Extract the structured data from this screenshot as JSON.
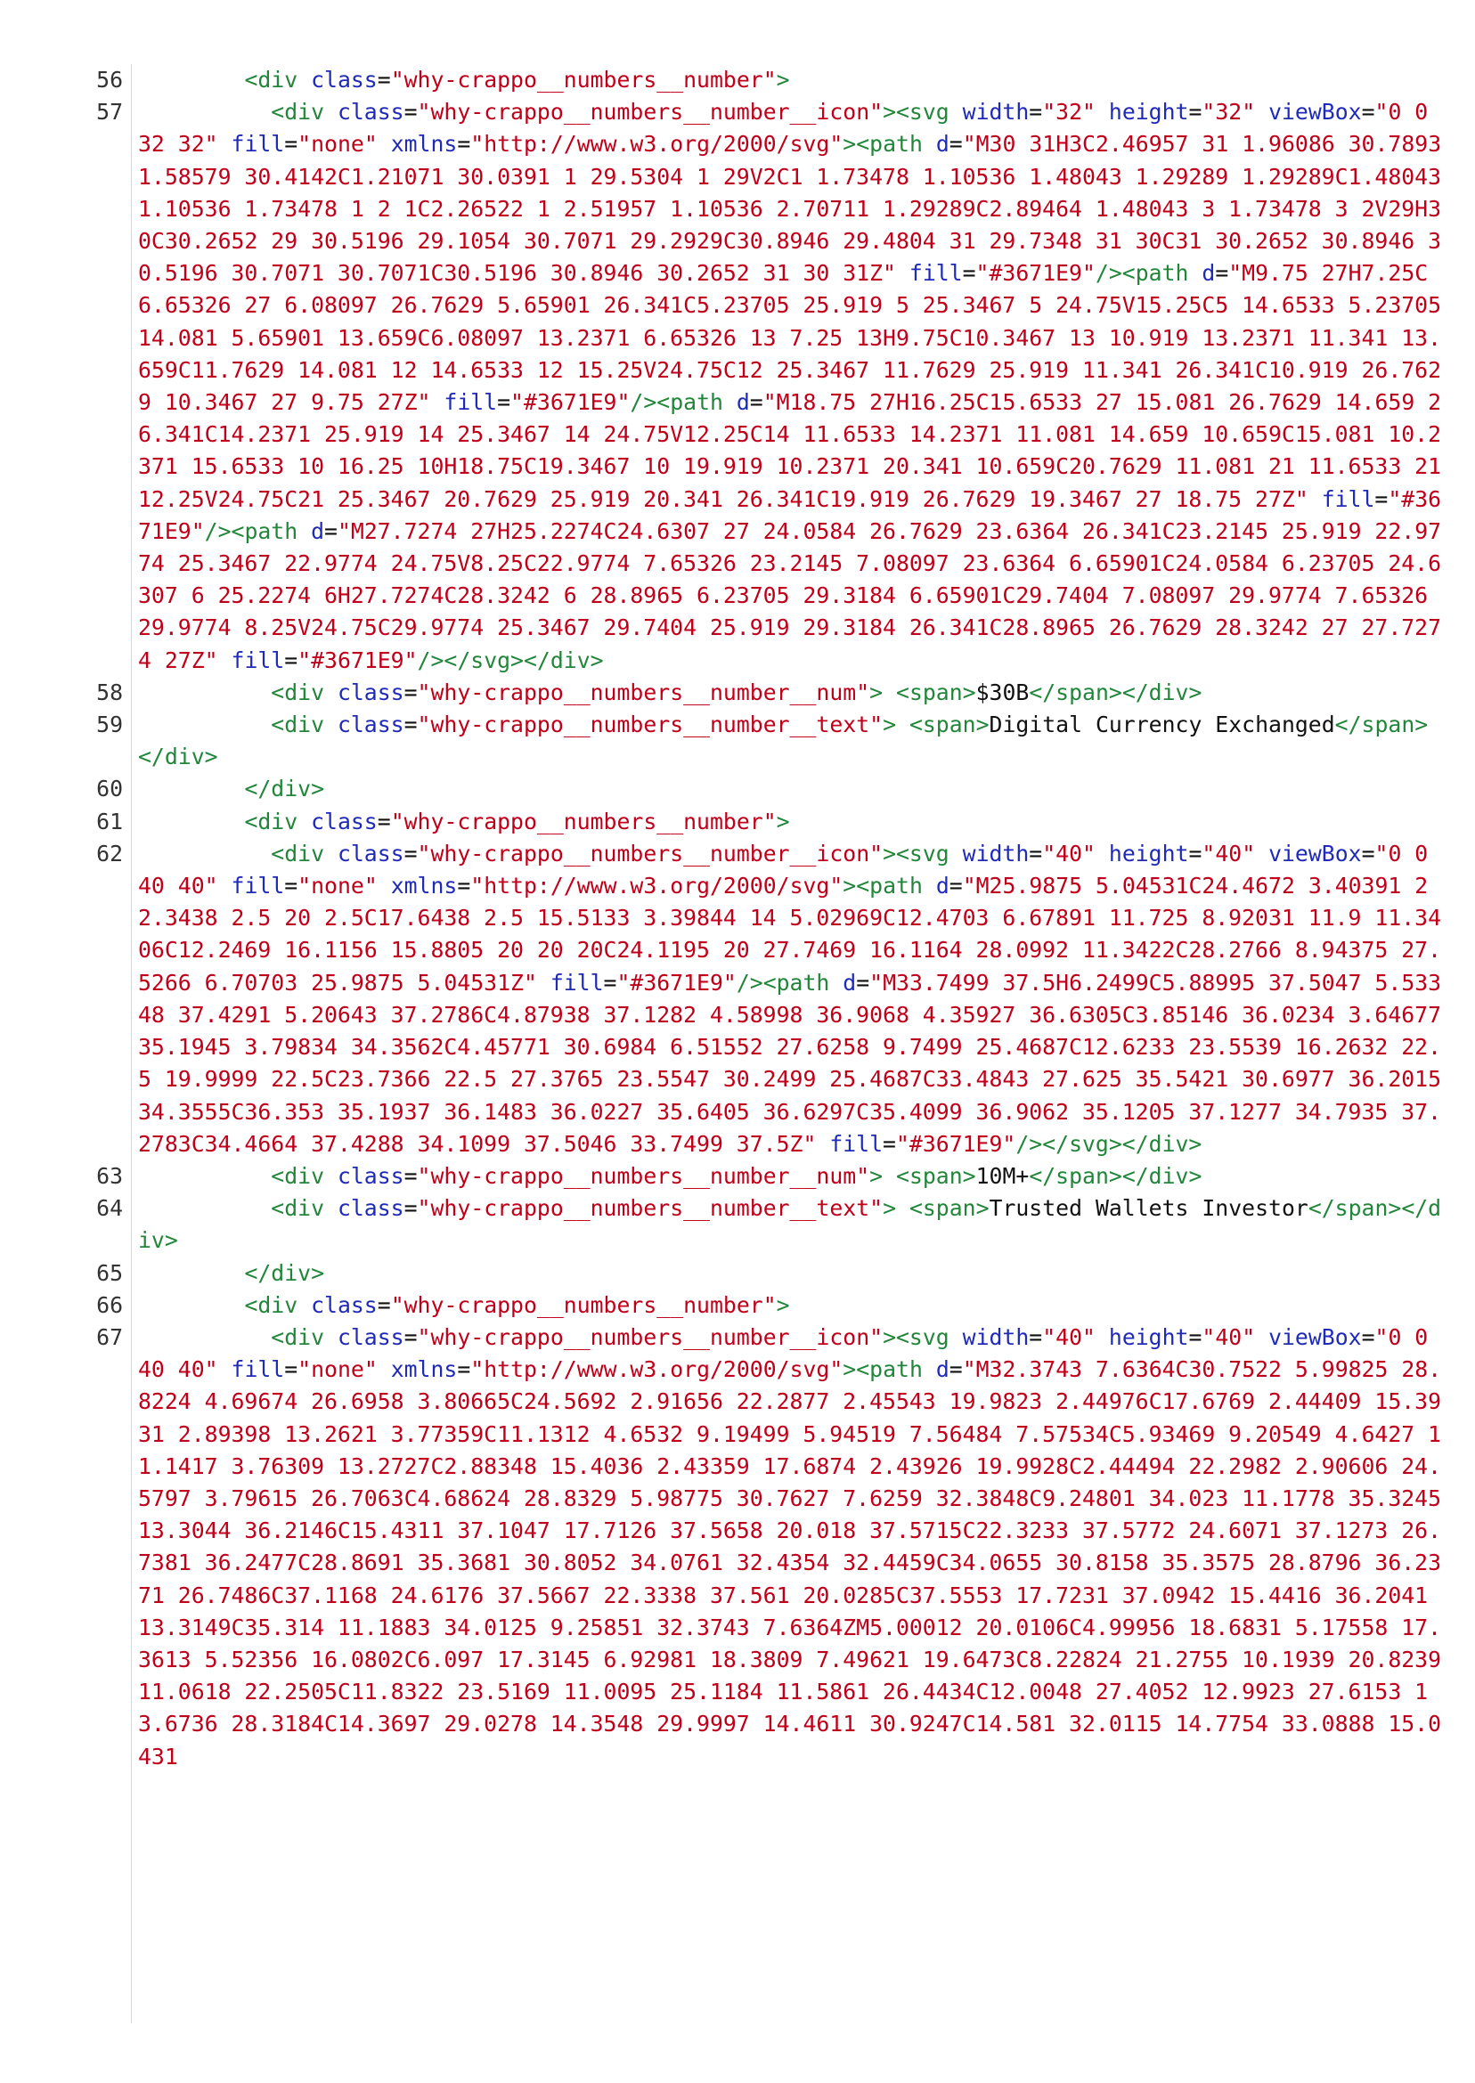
{
  "lines": [
    {
      "num": "56",
      "indent": "        ",
      "tokens": [
        {
          "t": "tg",
          "v": "<div "
        },
        {
          "t": "an",
          "v": "class"
        },
        {
          "t": "tx",
          "v": "="
        },
        {
          "t": "av",
          "v": "\"why-crappo__numbers__number\""
        },
        {
          "t": "tg",
          "v": ">"
        }
      ]
    },
    {
      "num": "57",
      "indent": "          ",
      "tokens": [
        {
          "t": "tg",
          "v": "<div "
        },
        {
          "t": "an",
          "v": "class"
        },
        {
          "t": "tx",
          "v": "="
        },
        {
          "t": "av",
          "v": "\"why-crappo__numbers__number__icon\""
        },
        {
          "t": "tg",
          "v": "><svg "
        },
        {
          "t": "an",
          "v": "width"
        },
        {
          "t": "tx",
          "v": "="
        },
        {
          "t": "av",
          "v": "\"32\""
        },
        {
          "t": "tx",
          "v": " "
        },
        {
          "t": "an",
          "v": "height"
        },
        {
          "t": "tx",
          "v": "="
        },
        {
          "t": "av",
          "v": "\"32\""
        },
        {
          "t": "tx",
          "v": " "
        },
        {
          "t": "an",
          "v": "viewBox"
        },
        {
          "t": "tx",
          "v": "="
        },
        {
          "t": "av",
          "v": "\"0 0 32 32\""
        },
        {
          "t": "tx",
          "v": " "
        },
        {
          "t": "an",
          "v": "fill"
        },
        {
          "t": "tx",
          "v": "="
        },
        {
          "t": "av",
          "v": "\"none\""
        },
        {
          "t": "tx",
          "v": " "
        },
        {
          "t": "an",
          "v": "xmlns"
        },
        {
          "t": "tx",
          "v": "="
        },
        {
          "t": "av",
          "v": "\"http://www.w3.org/2000/svg\""
        },
        {
          "t": "tg",
          "v": "><path "
        },
        {
          "t": "an",
          "v": "d"
        },
        {
          "t": "tx",
          "v": "="
        },
        {
          "t": "av",
          "v": "\"M30 31H3C2.46957 31 1.96086 30.7893 1.58579 30.4142C1.21071 30.0391 1 29.5304 1 29V2C1 1.73478 1.10536 1.48043 1.29289 1.29289C1.48043 1.10536 1.73478 1 2 1C2.26522 1 2.51957 1.10536 2.70711 1.29289C2.89464 1.48043 3 1.73478 3 2V29H30C30.2652 29 30.5196 29.1054 30.7071 29.2929C30.8946 29.4804 31 29.7348 31 30C31 30.2652 30.8946 30.5196 30.7071 30.7071C30.5196 30.8946 30.2652 31 30 31Z\""
        },
        {
          "t": "tx",
          "v": " "
        },
        {
          "t": "an",
          "v": "fill"
        },
        {
          "t": "tx",
          "v": "="
        },
        {
          "t": "av",
          "v": "\"#3671E9\""
        },
        {
          "t": "tg",
          "v": "/><path"
        },
        {
          "t": "tx",
          "v": " "
        },
        {
          "t": "an",
          "v": "d"
        },
        {
          "t": "tx",
          "v": "="
        },
        {
          "t": "av",
          "v": "\"M9.75 27H7.25C6.65326 27 6.08097 26.7629 5.65901 26.341C5.23705 25.919 5 25.3467 5 24.75V15.25C5 14.6533 5.23705 14.081 5.65901 13.659C6.08097 13.2371 6.65326 13 7.25 13H9.75C10.3467 13 10.919 13.2371 11.341 13.659C11.7629 14.081 12 14.6533 12 15.25V24.75C12 25.3467 11.7629 25.919 11.341 26.341C10.919 26.7629 10.3467 27 9.75 27Z\""
        },
        {
          "t": "tx",
          "v": " "
        },
        {
          "t": "an",
          "v": "fill"
        },
        {
          "t": "tx",
          "v": "="
        },
        {
          "t": "av",
          "v": "\"#3671E9\""
        },
        {
          "t": "tg",
          "v": "/><path "
        },
        {
          "t": "an",
          "v": "d"
        },
        {
          "t": "tx",
          "v": "="
        },
        {
          "t": "av",
          "v": "\"M18.75 27H16.25C15.6533 27 15.081 26.7629 14.659 26.341C14.2371 25.919 14 25.3467 14 24.75V12.25C14 11.6533 14.2371 11.081 14.659 10.659C15.081 10.2371 15.6533 10 16.25 10H18.75C19.3467 10 19.919 10.2371 20.341 10.659C20.7629 11.081 21 11.6533 21 12.25V24.75C21 25.3467 20.7629 25.919 20.341 26.341C19.919 26.7629 19.3467 27 18.75 27Z\""
        },
        {
          "t": "tx",
          "v": " "
        },
        {
          "t": "an",
          "v": "fill"
        },
        {
          "t": "tx",
          "v": "="
        },
        {
          "t": "av",
          "v": "\"#3671E9\""
        },
        {
          "t": "tg",
          "v": "/><path "
        },
        {
          "t": "an",
          "v": "d"
        },
        {
          "t": "tx",
          "v": "="
        },
        {
          "t": "av",
          "v": "\"M27.7274 27H25.2274C24.6307 27 24.0584 26.7629 23.6364 26.341C23.2145 25.919 22.9774 25.3467 22.9774 24.75V8.25C22.9774 7.65326 23.2145 7.08097 23.6364 6.65901C24.0584 6.23705 24.6307 6 25.2274 6H27.7274C28.3242 6 28.8965 6.23705 29.3184 6.65901C29.7404 7.08097 29.9774 7.65326 29.9774 8.25V24.75C29.9774 25.3467 29.7404 25.919 29.3184 26.341C28.8965 26.7629 28.3242 27 27.7274 27Z\""
        },
        {
          "t": "tx",
          "v": " "
        },
        {
          "t": "an",
          "v": "fill"
        },
        {
          "t": "tx",
          "v": "="
        },
        {
          "t": "av",
          "v": "\"#3671E9\""
        },
        {
          "t": "tg",
          "v": "/></svg></div>"
        }
      ]
    },
    {
      "num": "58",
      "indent": "          ",
      "tokens": [
        {
          "t": "tg",
          "v": "<div "
        },
        {
          "t": "an",
          "v": "class"
        },
        {
          "t": "tx",
          "v": "="
        },
        {
          "t": "av",
          "v": "\"why-crappo__numbers__number__num\""
        },
        {
          "t": "tg",
          "v": ">"
        },
        {
          "t": "tx",
          "v": " "
        },
        {
          "t": "tg",
          "v": "<span>"
        },
        {
          "t": "tx",
          "v": "$30B"
        },
        {
          "t": "tg",
          "v": "</span></div>"
        }
      ]
    },
    {
      "num": "59",
      "indent": "          ",
      "tokens": [
        {
          "t": "tg",
          "v": "<div "
        },
        {
          "t": "an",
          "v": "class"
        },
        {
          "t": "tx",
          "v": "="
        },
        {
          "t": "av",
          "v": "\"why-crappo__numbers__number__text\""
        },
        {
          "t": "tg",
          "v": ">"
        },
        {
          "t": "tx",
          "v": " "
        },
        {
          "t": "tg",
          "v": "<span>"
        },
        {
          "t": "tx",
          "v": "Digital Currency Exchanged"
        },
        {
          "t": "tg",
          "v": "</span></div>"
        }
      ]
    },
    {
      "num": "60",
      "indent": "        ",
      "tokens": [
        {
          "t": "tg",
          "v": "</div>"
        }
      ]
    },
    {
      "num": "61",
      "indent": "        ",
      "tokens": [
        {
          "t": "tg",
          "v": "<div "
        },
        {
          "t": "an",
          "v": "class"
        },
        {
          "t": "tx",
          "v": "="
        },
        {
          "t": "av",
          "v": "\"why-crappo__numbers__number\""
        },
        {
          "t": "tg",
          "v": ">"
        }
      ]
    },
    {
      "num": "62",
      "indent": "          ",
      "tokens": [
        {
          "t": "tg",
          "v": "<div "
        },
        {
          "t": "an",
          "v": "class"
        },
        {
          "t": "tx",
          "v": "="
        },
        {
          "t": "av",
          "v": "\"why-crappo__numbers__number__icon\""
        },
        {
          "t": "tg",
          "v": "><svg "
        },
        {
          "t": "an",
          "v": "width"
        },
        {
          "t": "tx",
          "v": "="
        },
        {
          "t": "av",
          "v": "\"40\""
        },
        {
          "t": "tx",
          "v": " "
        },
        {
          "t": "an",
          "v": "height"
        },
        {
          "t": "tx",
          "v": "="
        },
        {
          "t": "av",
          "v": "\"40\""
        },
        {
          "t": "tx",
          "v": " "
        },
        {
          "t": "an",
          "v": "viewBox"
        },
        {
          "t": "tx",
          "v": "="
        },
        {
          "t": "av",
          "v": "\"0 0 40 40\""
        },
        {
          "t": "tx",
          "v": " "
        },
        {
          "t": "an",
          "v": "fill"
        },
        {
          "t": "tx",
          "v": "="
        },
        {
          "t": "av",
          "v": "\"none\""
        },
        {
          "t": "tx",
          "v": " "
        },
        {
          "t": "an",
          "v": "xmlns"
        },
        {
          "t": "tx",
          "v": "="
        },
        {
          "t": "av",
          "v": "\"http://www.w3.org/2000/svg\""
        },
        {
          "t": "tg",
          "v": "><path "
        },
        {
          "t": "an",
          "v": "d"
        },
        {
          "t": "tx",
          "v": "="
        },
        {
          "t": "av",
          "v": "\"M25.9875 5.04531C24.4672 3.40391 22.3438 2.5 20 2.5C17.6438 2.5 15.5133 3.39844 14 5.02969C12.4703 6.67891 11.725 8.92031 11.9 11.3406C12.2469 16.1156 15.8805 20 20 20C24.1195 20 27.7469 16.1164 28.0992 11.3422C28.2766 8.94375 27.5266 6.70703 25.9875 5.04531Z\""
        },
        {
          "t": "tx",
          "v": " "
        },
        {
          "t": "an",
          "v": "fill"
        },
        {
          "t": "tx",
          "v": "="
        },
        {
          "t": "av",
          "v": "\"#3671E9\""
        },
        {
          "t": "tg",
          "v": "/><path "
        },
        {
          "t": "an",
          "v": "d"
        },
        {
          "t": "tx",
          "v": "="
        },
        {
          "t": "av",
          "v": "\"M33.7499 37.5H6.2499C5.88995 37.5047 5.53348 37.4291 5.20643 37.2786C4.87938 37.1282 4.58998 36.9068 4.35927 36.6305C3.85146 36.0234 3.64677 35.1945 3.79834 34.3562C4.45771 30.6984 6.51552 27.6258 9.7499 25.4687C12.6233 23.5539 16.2632 22.5 19.9999 22.5C23.7366 22.5 27.3765 23.5547 30.2499 25.4687C33.4843 27.625 35.5421 30.6977 36.2015 34.3555C36.353 35.1937 36.1483 36.0227 35.6405 36.6297C35.4099 36.9062 35.1205 37.1277 34.7935 37.2783C34.4664 37.4288 34.1099 37.5046 33.7499 37.5Z\""
        },
        {
          "t": "tx",
          "v": " "
        },
        {
          "t": "an",
          "v": "fill"
        },
        {
          "t": "tx",
          "v": "="
        },
        {
          "t": "av",
          "v": "\"#3671E9\""
        },
        {
          "t": "tg",
          "v": "/></svg></div>"
        }
      ]
    },
    {
      "num": "63",
      "indent": "          ",
      "tokens": [
        {
          "t": "tg",
          "v": "<div "
        },
        {
          "t": "an",
          "v": "class"
        },
        {
          "t": "tx",
          "v": "="
        },
        {
          "t": "av",
          "v": "\"why-crappo__numbers__number__num\""
        },
        {
          "t": "tg",
          "v": ">"
        },
        {
          "t": "tx",
          "v": " "
        },
        {
          "t": "tg",
          "v": "<span>"
        },
        {
          "t": "tx",
          "v": "10M+"
        },
        {
          "t": "tg",
          "v": "</span></div>"
        }
      ]
    },
    {
      "num": "64",
      "indent": "          ",
      "tokens": [
        {
          "t": "tg",
          "v": "<div "
        },
        {
          "t": "an",
          "v": "class"
        },
        {
          "t": "tx",
          "v": "="
        },
        {
          "t": "av",
          "v": "\"why-crappo__numbers__number__text\""
        },
        {
          "t": "tg",
          "v": ">"
        },
        {
          "t": "tx",
          "v": " "
        },
        {
          "t": "tg",
          "v": "<span>"
        },
        {
          "t": "tx",
          "v": "Trusted Wallets Investor"
        },
        {
          "t": "tg",
          "v": "</span></div>"
        }
      ]
    },
    {
      "num": "65",
      "indent": "        ",
      "tokens": [
        {
          "t": "tg",
          "v": "</div>"
        }
      ]
    },
    {
      "num": "66",
      "indent": "        ",
      "tokens": [
        {
          "t": "tg",
          "v": "<div "
        },
        {
          "t": "an",
          "v": "class"
        },
        {
          "t": "tx",
          "v": "="
        },
        {
          "t": "av",
          "v": "\"why-crappo__numbers__number\""
        },
        {
          "t": "tg",
          "v": ">"
        }
      ]
    },
    {
      "num": "67",
      "indent": "          ",
      "tokens": [
        {
          "t": "tg",
          "v": "<div "
        },
        {
          "t": "an",
          "v": "class"
        },
        {
          "t": "tx",
          "v": "="
        },
        {
          "t": "av",
          "v": "\"why-crappo__numbers__number__icon\""
        },
        {
          "t": "tg",
          "v": "><svg "
        },
        {
          "t": "an",
          "v": "width"
        },
        {
          "t": "tx",
          "v": "="
        },
        {
          "t": "av",
          "v": "\"40\""
        },
        {
          "t": "tx",
          "v": " "
        },
        {
          "t": "an",
          "v": "height"
        },
        {
          "t": "tx",
          "v": "="
        },
        {
          "t": "av",
          "v": "\"40\""
        },
        {
          "t": "tx",
          "v": " "
        },
        {
          "t": "an",
          "v": "viewBox"
        },
        {
          "t": "tx",
          "v": "="
        },
        {
          "t": "av",
          "v": "\"0 0 40 40\""
        },
        {
          "t": "tx",
          "v": " "
        },
        {
          "t": "an",
          "v": "fill"
        },
        {
          "t": "tx",
          "v": "="
        },
        {
          "t": "av",
          "v": "\"none\""
        },
        {
          "t": "tx",
          "v": " "
        },
        {
          "t": "an",
          "v": "xmlns"
        },
        {
          "t": "tx",
          "v": "="
        },
        {
          "t": "av",
          "v": "\"http://www.w3.org/2000/svg\""
        },
        {
          "t": "tg",
          "v": "><path "
        },
        {
          "t": "an",
          "v": "d"
        },
        {
          "t": "tx",
          "v": "="
        },
        {
          "t": "av",
          "v": "\"M32.3743 7.6364C30.7522 5.99825 28.8224 4.69674 26.6958 3.80665C24.5692 2.91656 22.2877 2.45543 19.9823 2.44976C17.6769 2.44409 15.3931 2.89398 13.2621 3.77359C11.1312 4.6532 9.19499 5.94519 7.56484 7.57534C5.93469 9.20549 4.6427 11.1417 3.76309 13.2727C2.88348 15.4036 2.43359 17.6874 2.43926 19.9928C2.44494 22.2982 2.90606 24.5797 3.79615 26.7063C4.68624 28.8329 5.98775 30.7627 7.6259 32.3848C9.24801 34.023 11.1778 35.3245 13.3044 36.2146C15.4311 37.1047 17.7126 37.5658 20.018 37.5715C22.3233 37.5772 24.6071 37.1273 26.7381 36.2477C28.8691 35.3681 30.8052 34.0761 32.4354 32.4459C34.0655 30.8158 35.3575 28.8796 36.2371 26.7486C37.1168 24.6176 37.5667 22.3338 37.561 20.0285C37.5553 17.7231 37.0942 15.4416 36.2041 13.3149C35.314 11.1883 34.0125 9.25851 32.3743 7.6364ZM5.00012 20.0106C4.99956 18.6831 5.17558 17.3613 5.52356 16.0802C6.097 17.3145 6.92981 18.3809 7.49621 19.6473C8.22824 21.2755 10.1939 20.8239 11.0618 22.2505C11.8322 23.5169 11.0095 25.1184 11.5861 26.4434C12.0048 27.4052 12.9923 27.6153 13.6736 28.3184C14.3697 29.0278 14.3548 29.9997 14.4611 30.9247C14.581 32.0115 14.7754 33.0888 15.0431"
        }
      ]
    }
  ]
}
